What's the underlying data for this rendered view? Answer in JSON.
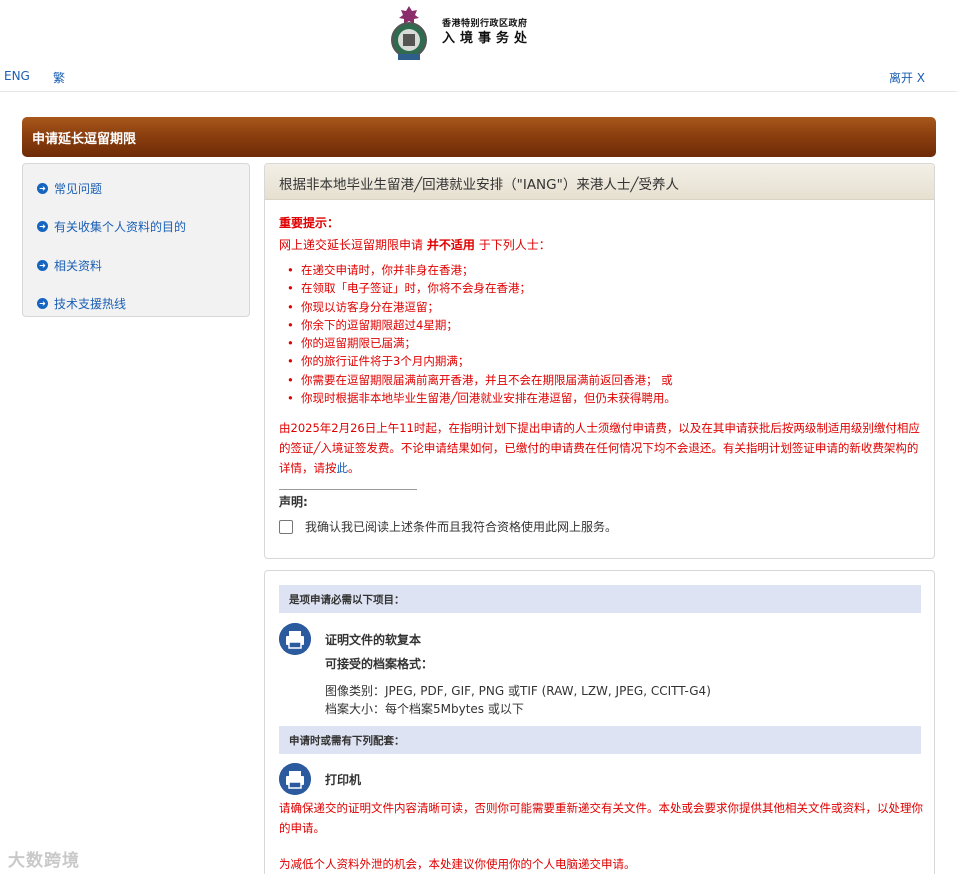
{
  "header": {
    "org_line1": "香港特别行政区政府",
    "org_line2": "入境事务处"
  },
  "lang_bar": {
    "eng": "ENG",
    "traditional": "繁",
    "leave": "离开 X"
  },
  "page_title": "申请延长逗留期限",
  "sidebar": {
    "items": [
      {
        "label": "常见问题"
      },
      {
        "label": "有关收集个人资料的目的"
      },
      {
        "label": "相关资料"
      },
      {
        "label": "技术支援热线"
      }
    ]
  },
  "main_panel": {
    "heading": "根据非本地毕业生留港╱回港就业安排（\"IANG\"）来港人士╱受养人",
    "notice_title": "重要提示：",
    "notice_intro_pre": "网上递交延长逗留期限申请",
    "notice_intro_bold": "并不适用",
    "notice_intro_post": "于下列人士：",
    "notice_items": [
      "在递交申请时，你并非身在香港；",
      "在领取「电子签证」时，你将不会身在香港；",
      "你现以访客身分在港逗留；",
      "你余下的逗留期限超过4星期；",
      "你的逗留期限已届满；",
      "你的旅行证件将于3个月内期满；",
      "你需要在逗留期限届满前离开香港，并且不会在期限届满前返回香港； 或",
      "你现时根据非本地毕业生留港╱回港就业安排在港逗留，但仍未获得聘用。"
    ],
    "fee_note": "由2025年2月26日上午11时起，在指明计划下提出申请的人士须缴付申请费，以及在其申请获批后按两级制适用级别缴付相应的签证╱入境证签发费。不论申请结果如何，已缴付的申请费在任何情况下均不会退还。有关指明计划签证申请的新收费架构的详情，请按",
    "fee_link": "此",
    "fee_end": "。",
    "declaration_title": "声明:",
    "declaration_text": "我确认我已阅读上述条件而且我符合资格使用此网上服务。"
  },
  "requirements": {
    "band1": "是项申请必需以下项目：",
    "item1_label": "证明文件的软复本",
    "formats_title": "可接受的档案格式：",
    "format_image": "图像类别：JPEG, PDF, GIF, PNG 或TIF (RAW, LZW, JPEG, CCITT-G4)",
    "format_size": "档案大小：每个档案5Mbytes 或以下",
    "band2": "申请时或需有下列配套：",
    "item2_label": "打印机",
    "warning1": "请确保递交的证明文件内容清晰可读，否则你可能需要重新递交有关文件。本处或会要求你提供其他相关文件或资料，以处理你的申请。",
    "warning2": "为减低个人资料外泄的机会，本处建议你使用你的个人电脑递交申请。"
  },
  "watermark": "大数跨境",
  "colors": {
    "title_bar": "#8c3f0f",
    "link": "#1a5fb4",
    "notice_red": "#e00000",
    "band_blue": "#dde3f2",
    "icon_blue": "#2c5a9e"
  }
}
